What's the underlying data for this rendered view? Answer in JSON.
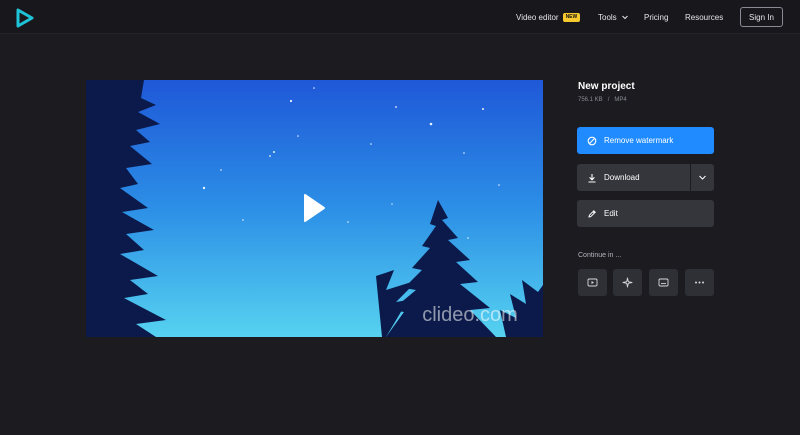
{
  "header": {
    "nav": {
      "video_editor": "Video editor",
      "new_badge": "NEW",
      "tools": "Tools",
      "pricing": "Pricing",
      "resources": "Resources"
    },
    "sign_in": "Sign In"
  },
  "video": {
    "watermark": "clideo.com"
  },
  "project": {
    "title": "New project",
    "size": "756.1 KB",
    "separator": "/",
    "format": "MP4"
  },
  "actions": {
    "remove_watermark": "Remove watermark",
    "download": "Download",
    "edit": "Edit"
  },
  "continue_label": "Continue in ...",
  "colors": {
    "accent": "#1f8bff",
    "badge": "#f6c92e",
    "logo": "#1fc3d8",
    "background": "#1b1b20"
  },
  "icons": {
    "logo": "play-logo-icon",
    "remove": "no-watermark-icon",
    "download": "download-icon",
    "edit": "pencil-icon",
    "continue_tools": [
      "video-player-icon",
      "sparkle-icon",
      "subtitles-icon",
      "more-dots-icon"
    ]
  }
}
